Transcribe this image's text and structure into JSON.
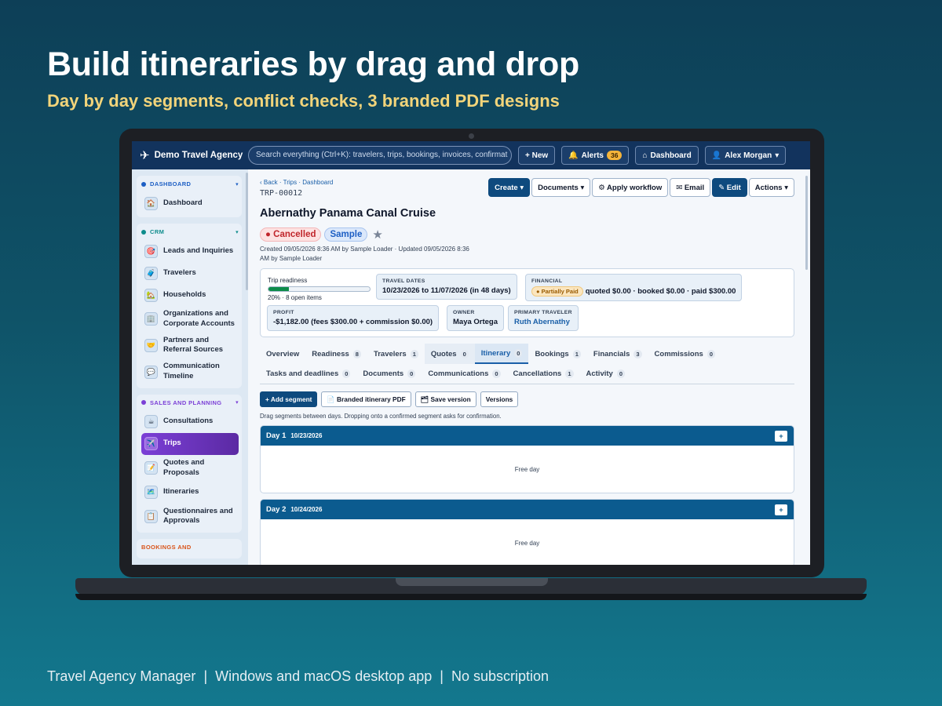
{
  "promo": {
    "title": "Build itineraries by drag and drop",
    "subtitle": "Day by day segments, conflict checks, 3 branded PDF designs",
    "footer": [
      "Travel Agency Manager",
      "Windows and macOS desktop app",
      "No subscription"
    ],
    "separator": "|"
  },
  "app": {
    "brand": "Demo Travel Agency",
    "search_placeholder": "Search everything (Ctrl+K): travelers, trips, bookings, invoices, confirmat",
    "new_label": "+ New",
    "alerts_label": "Alerts",
    "alerts_count": "36",
    "dashboard_label": "Dashboard",
    "user_label": "Alex Morgan"
  },
  "sidebar": {
    "sections": [
      {
        "title": "DASHBOARD",
        "color": "#1d5fc4",
        "items": [
          {
            "label": "Dashboard",
            "icon": "home-icon",
            "glyph": "🏠"
          }
        ]
      },
      {
        "title": "CRM",
        "color": "#0e8c8c",
        "items": [
          {
            "label": "Leads and Inquiries",
            "icon": "target-icon",
            "glyph": "🎯"
          },
          {
            "label": "Travelers",
            "icon": "luggage-icon",
            "glyph": "🧳"
          },
          {
            "label": "Households",
            "icon": "house-icon",
            "glyph": "🏡"
          },
          {
            "label": "Organizations and Corporate Accounts",
            "icon": "building-icon",
            "glyph": "🏢"
          },
          {
            "label": "Partners and Referral Sources",
            "icon": "handshake-icon",
            "glyph": "🤝"
          },
          {
            "label": "Communication Timeline",
            "icon": "chat-icon",
            "glyph": "💬"
          }
        ]
      },
      {
        "title": "SALES AND PLANNING",
        "color": "#7b3fd6",
        "items": [
          {
            "label": "Consultations",
            "icon": "coffee-icon",
            "glyph": "☕"
          },
          {
            "label": "Trips",
            "icon": "airplane-icon",
            "glyph": "✈️",
            "active": true
          },
          {
            "label": "Quotes and Proposals",
            "icon": "memo-icon",
            "glyph": "📝"
          },
          {
            "label": "Itineraries",
            "icon": "map-icon",
            "glyph": "🗺️"
          },
          {
            "label": "Questionnaires and Approvals",
            "icon": "clipboard-icon",
            "glyph": "📋"
          }
        ]
      }
    ],
    "partial_section": "BOOKINGS AND"
  },
  "trip": {
    "breadcrumb": "‹ Back · Trips · Dashboard",
    "number": "TRP-00012",
    "title": "Abernathy Panama Canal Cruise",
    "status": "Cancelled",
    "sample_tag": "Sample",
    "meta": "Created 09/05/2026 8:36 AM by Sample Loader · Updated 09/05/2026 8:36 AM by Sample Loader",
    "actions": [
      "Create ▾",
      "Documents ▾",
      "⚙ Apply workflow",
      "✉ Email",
      "✎ Edit",
      "Actions ▾"
    ]
  },
  "summary": {
    "readiness_label": "Trip readiness",
    "readiness_fraction": 0.2,
    "readiness_text": "20% · 8 open items",
    "travel_dates_label": "TRAVEL DATES",
    "travel_dates": "10/23/2026 to 11/07/2026 (in 48 days)",
    "financial_label": "FINANCIAL",
    "financial_status": "Partially Paid",
    "financial_text": "quoted $0.00 · booked $0.00 · paid $300.00",
    "profit_label": "PROFIT",
    "profit": "-$1,182.00 (fees $300.00 + commission $0.00)",
    "owner_label": "OWNER",
    "owner": "Maya Ortega",
    "traveler_label": "PRIMARY TRAVELER",
    "traveler": "Ruth Abernathy"
  },
  "tabs": {
    "row1": [
      {
        "label": "Overview",
        "count": ""
      },
      {
        "label": "Readiness",
        "count": "8"
      },
      {
        "label": "Travelers",
        "count": "1"
      },
      {
        "label": "Quotes",
        "count": "0"
      },
      {
        "label": "Itinerary",
        "count": "0",
        "active": true
      },
      {
        "label": "Bookings",
        "count": "1"
      },
      {
        "label": "Financials",
        "count": "3"
      },
      {
        "label": "Commissions",
        "count": "0"
      }
    ],
    "row2": [
      {
        "label": "Tasks and deadlines",
        "count": "0"
      },
      {
        "label": "Documents",
        "count": "0"
      },
      {
        "label": "Communications",
        "count": "0"
      },
      {
        "label": "Cancellations",
        "count": "1"
      },
      {
        "label": "Activity",
        "count": "0"
      }
    ]
  },
  "itinerary": {
    "buttons": [
      "+ Add segment",
      "📄 Branded itinerary PDF",
      "🗂 Save version",
      "Versions"
    ],
    "hint": "Drag segments between days. Dropping onto a confirmed segment asks for confirmation.",
    "days": [
      {
        "name": "Day 1",
        "date": "10/23/2026",
        "body": "Free day",
        "plus": "+"
      },
      {
        "name": "Day 2",
        "date": "10/24/2026",
        "body": "Free day",
        "plus": "+"
      }
    ]
  }
}
